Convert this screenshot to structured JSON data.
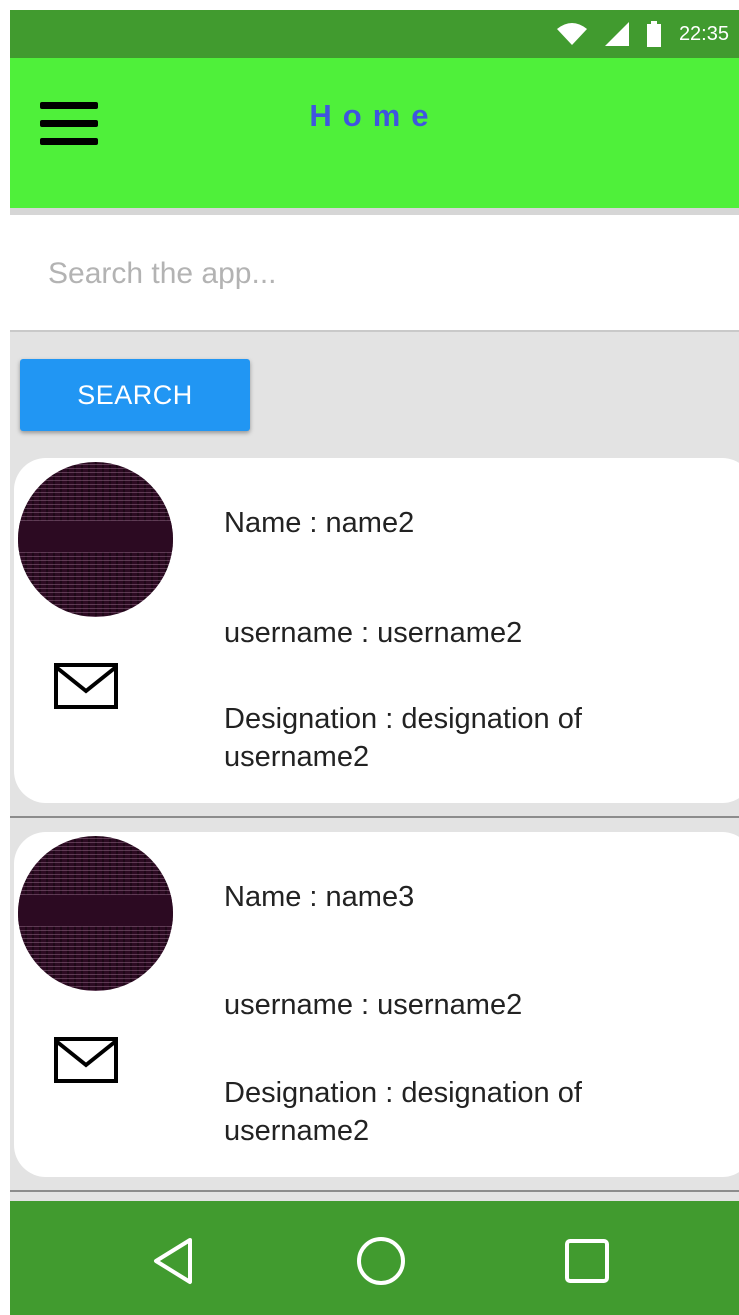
{
  "status_bar": {
    "time": "22:35",
    "icons": [
      "wifi-icon",
      "signal-icon",
      "battery-icon"
    ]
  },
  "app_bar": {
    "title": "Home",
    "menu_icon": "menu-icon"
  },
  "search": {
    "placeholder": "Search the app...",
    "value": "",
    "button_label": "SEARCH"
  },
  "cards": [
    {
      "name": "Name : name2",
      "username": "username : username2",
      "designation": "Designation : designation of username2"
    },
    {
      "name": "Name : name3",
      "username": "username : username2",
      "designation": "Designation : designation of username2"
    }
  ],
  "nav_bar": {
    "icons": [
      "back-icon",
      "home-icon",
      "recents-icon"
    ]
  },
  "colors": {
    "status_bar": "#419b2f",
    "app_bar": "#4ff03a",
    "title": "#3f55e0",
    "search_button": "#2196f3",
    "nav_bar": "#419b2f"
  }
}
